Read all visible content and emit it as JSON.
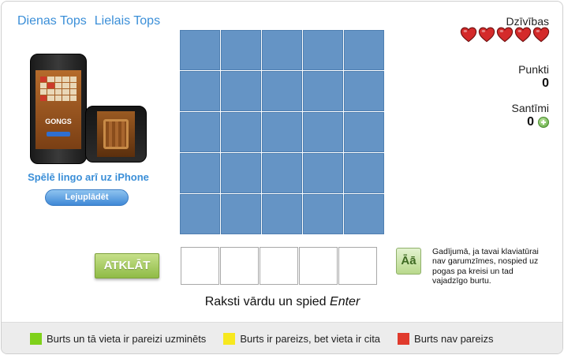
{
  "nav": {
    "daily_top": "Dienas Tops",
    "big_top": "Lielais Tops"
  },
  "promo": {
    "phone_word": "GONGS",
    "text": "Spēlē lingo arī uz iPhone",
    "download_label": "Lejuplādēt"
  },
  "stats": {
    "lives_label": "Dzīvības",
    "lives_count": 5,
    "points_label": "Punkti",
    "points_value": "0",
    "cents_label": "Santīmi",
    "cents_value": "0"
  },
  "board": {
    "rows": 5,
    "cols": 5,
    "cell_color": "#6594c5"
  },
  "actions": {
    "reveal_label": "ATKLĀT",
    "accent_label": "Āā",
    "accent_help": "Gadījumā, ja tavai klaviatūrai nav garumzīmes, nospied uz pogas pa kreisi un tad vajadzīgo burtu."
  },
  "instruction": {
    "text": "Raksti vārdu un spied ",
    "key": "Enter"
  },
  "legend": [
    {
      "color": "#7fd11a",
      "label": "Burts un tā vieta ir pareizi uzminēts"
    },
    {
      "color": "#f7e81e",
      "label": "Burts ir pareizs, bet vieta ir cita"
    },
    {
      "color": "#e03a2c",
      "label": "Burts nav pareizs"
    }
  ]
}
